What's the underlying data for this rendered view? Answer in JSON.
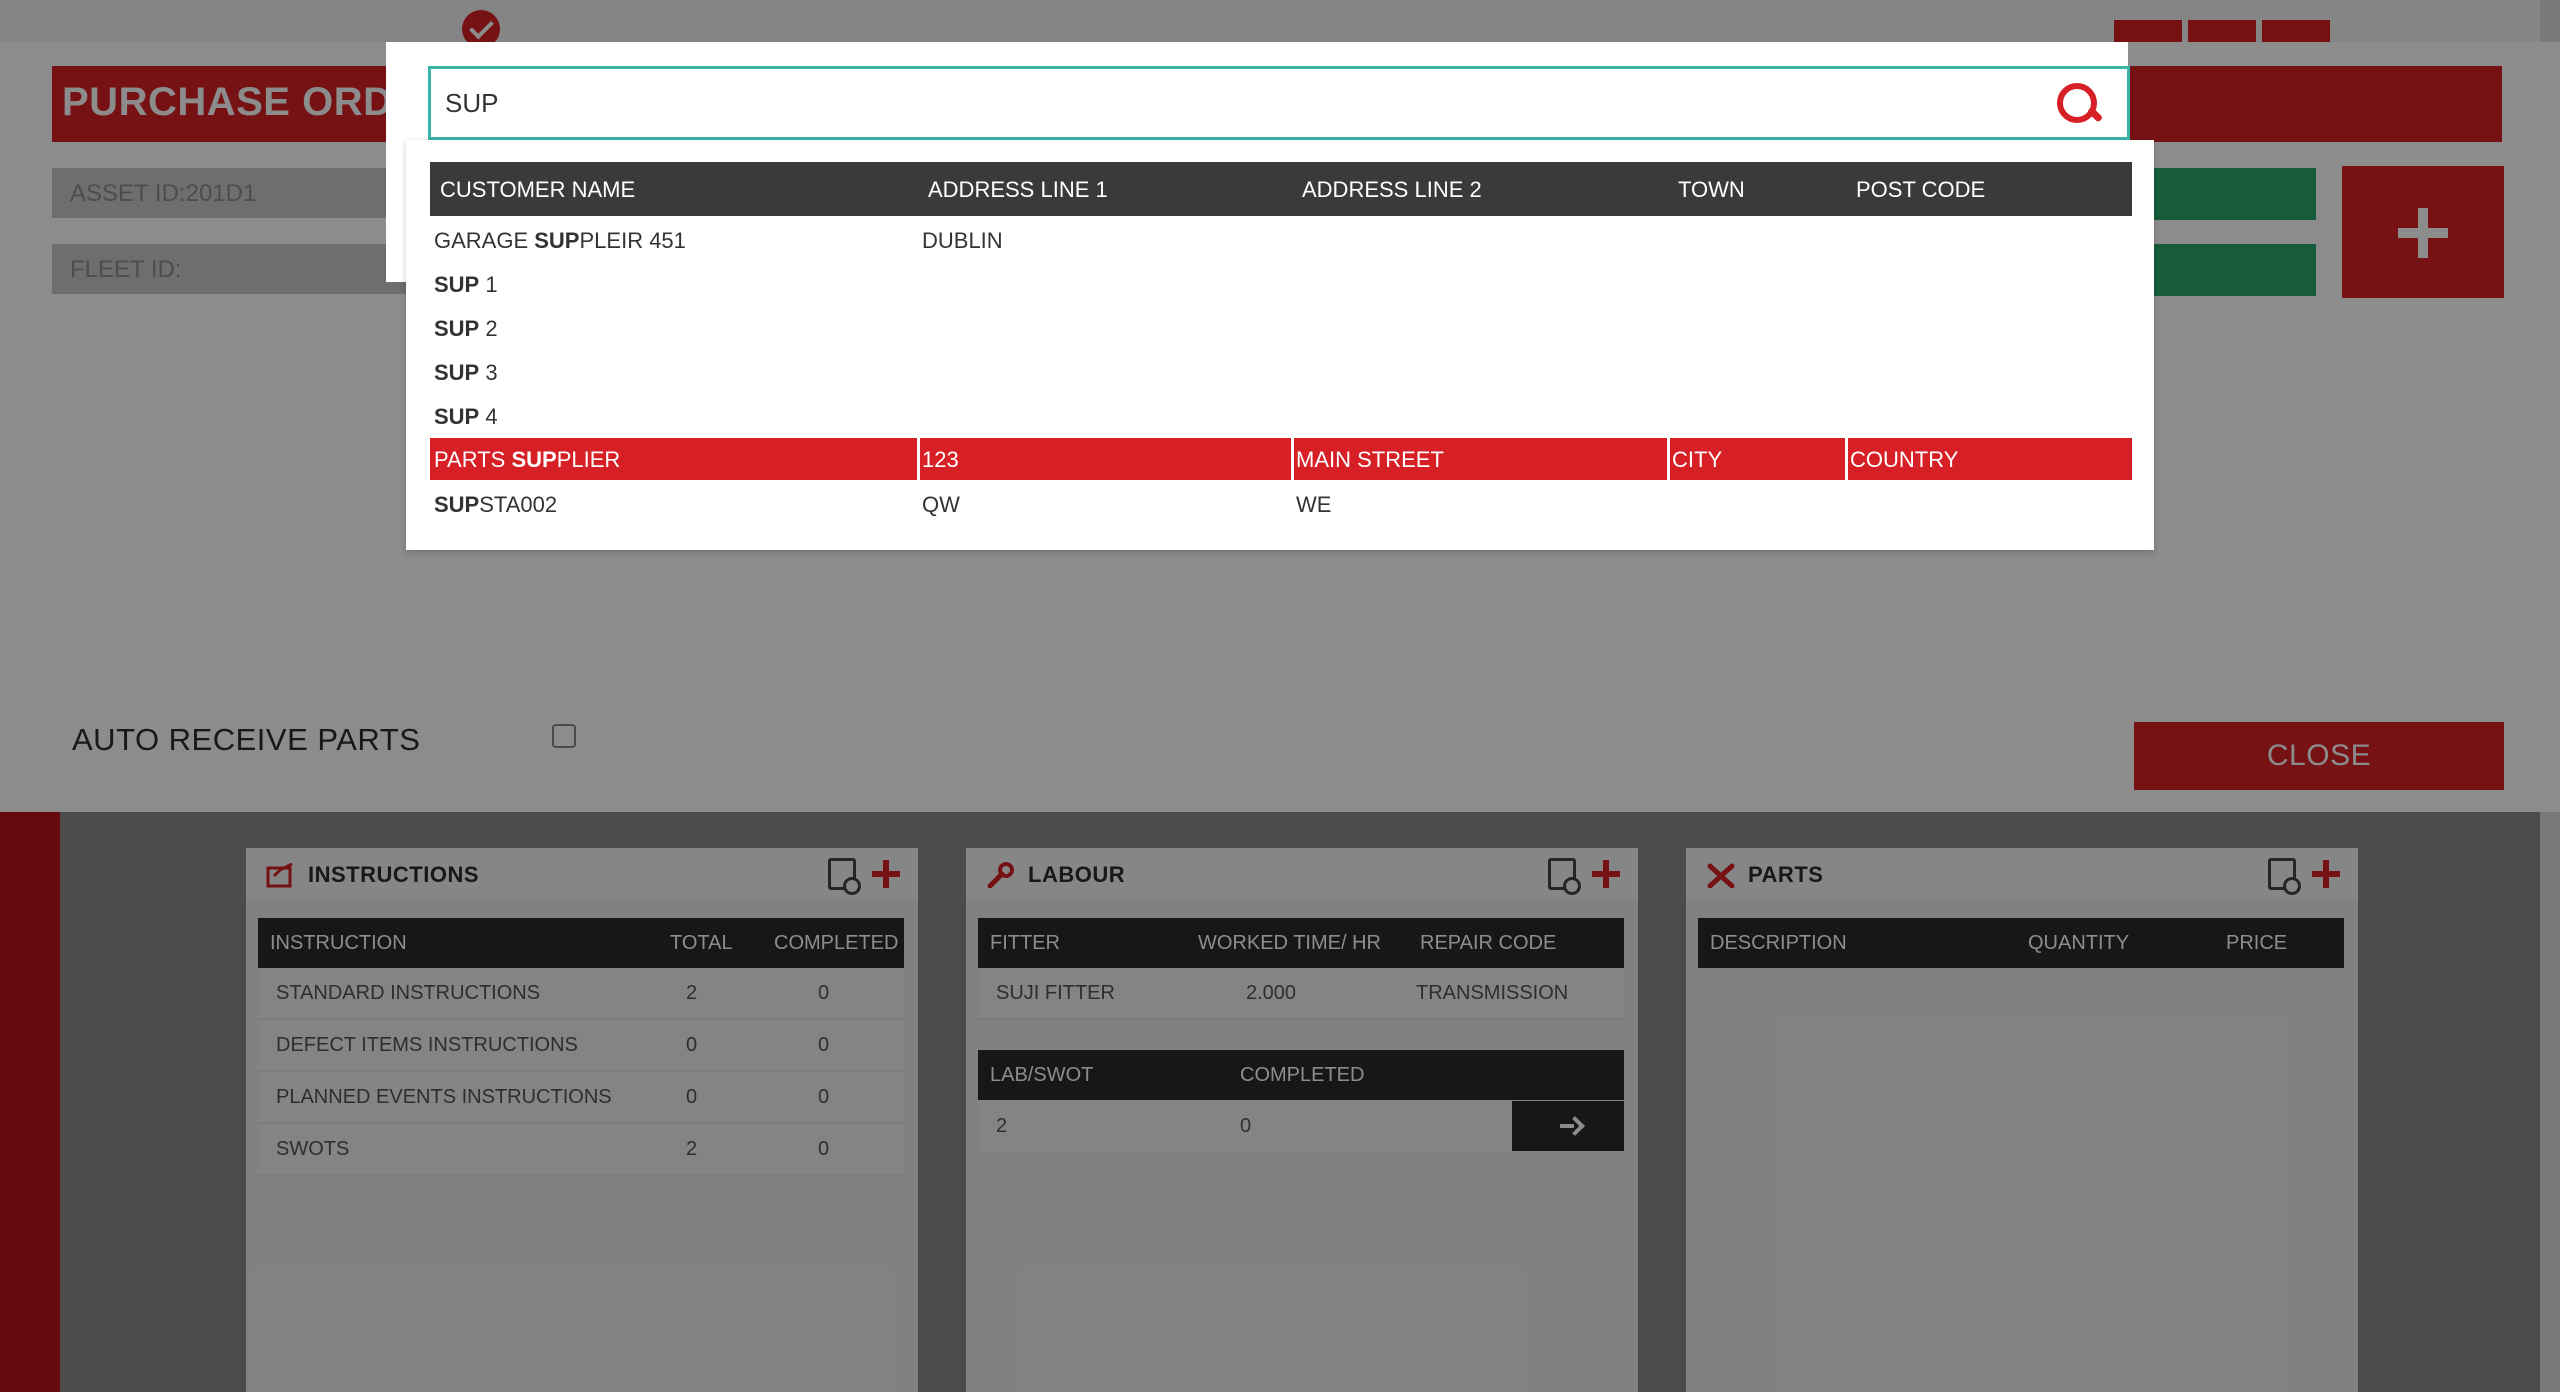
{
  "page": {
    "title": "PURCHASE ORDER",
    "asset_id": "ASSET ID:201D1",
    "fleet_id": "FLEET ID:",
    "auto_receive_label": "AUTO RECEIVE PARTS",
    "close_label": "CLOSE"
  },
  "search": {
    "value": "SUP",
    "placeholder": ""
  },
  "results": {
    "columns": [
      "CUSTOMER NAME",
      "ADDRESS LINE 1",
      "ADDRESS LINE 2",
      "TOWN",
      "POST CODE"
    ],
    "rows": [
      {
        "pre": "GARAGE ",
        "match": "SUP",
        "post": "PLEIR 451",
        "addr1": "DUBLIN",
        "addr2": "",
        "town": "",
        "postcode": "",
        "selected": false
      },
      {
        "pre": "",
        "match": "SUP",
        "post": " 1",
        "addr1": "",
        "addr2": "",
        "town": "",
        "postcode": "",
        "selected": false
      },
      {
        "pre": "",
        "match": "SUP",
        "post": " 2",
        "addr1": "",
        "addr2": "",
        "town": "",
        "postcode": "",
        "selected": false
      },
      {
        "pre": "",
        "match": "SUP",
        "post": " 3",
        "addr1": "",
        "addr2": "",
        "town": "",
        "postcode": "",
        "selected": false
      },
      {
        "pre": "",
        "match": "SUP",
        "post": " 4",
        "addr1": "",
        "addr2": "",
        "town": "",
        "postcode": "",
        "selected": false
      },
      {
        "pre": "PARTS ",
        "match": "SUP",
        "post": "PLIER",
        "addr1": "123",
        "addr2": "MAIN STREET",
        "town": "CITY",
        "postcode": "COUNTRY",
        "selected": true
      },
      {
        "pre": "",
        "match": "SUP",
        "post": "STA002",
        "addr1": "QW",
        "addr2": "WE",
        "town": "",
        "postcode": "",
        "selected": false
      }
    ]
  },
  "instructions": {
    "title": "INSTRUCTIONS",
    "headers": [
      "INSTRUCTION",
      "TOTAL",
      "COMPLETED"
    ],
    "rows": [
      [
        "STANDARD INSTRUCTIONS",
        "2",
        "0"
      ],
      [
        "DEFECT ITEMS INSTRUCTIONS",
        "0",
        "0"
      ],
      [
        "PLANNED EVENTS INSTRUCTIONS",
        "0",
        "0"
      ],
      [
        "SWOTS",
        "2",
        "0"
      ]
    ]
  },
  "labour": {
    "title": "LABOUR",
    "headers": [
      "FITTER",
      "WORKED TIME/ HR",
      "REPAIR CODE"
    ],
    "rows": [
      [
        "SUJI FITTER",
        "2.000",
        "TRANSMISSION"
      ]
    ],
    "swot_headers": [
      "LAB/SWOT",
      "COMPLETED"
    ],
    "swot_rows": [
      [
        "2",
        "0"
      ]
    ]
  },
  "parts": {
    "title": "PARTS",
    "headers": [
      "DESCRIPTION",
      "QUANTITY",
      "PRICE"
    ]
  },
  "colors": {
    "accent": "#d71f26",
    "search_border": "#3ab5a8",
    "dark_header": "#3a3a3a"
  },
  "icons": [
    "check-icon",
    "plus-icon",
    "search-icon",
    "document-search-icon",
    "instructions-icon",
    "wrench-icon",
    "tools-icon",
    "arrow-right-icon"
  ]
}
